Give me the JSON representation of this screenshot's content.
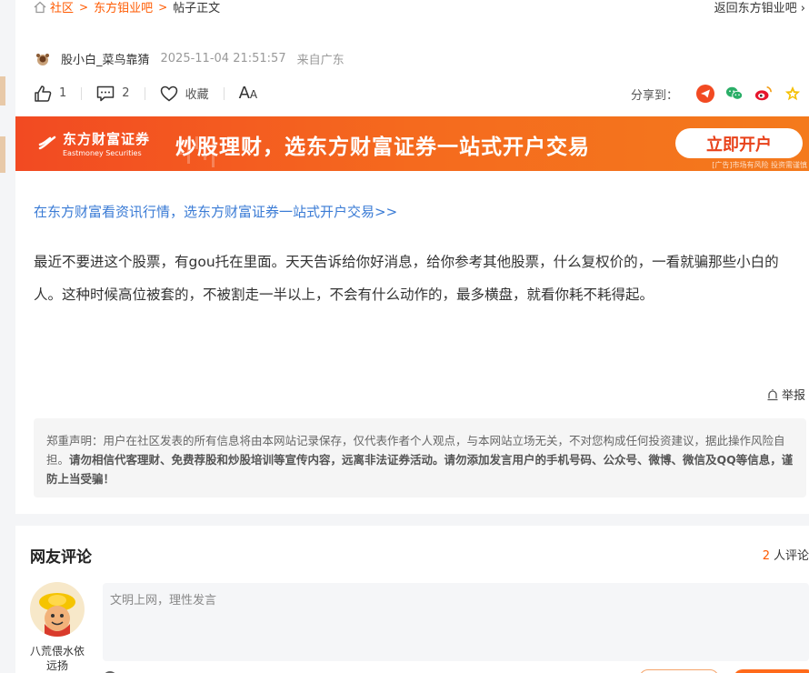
{
  "breadcrumb": {
    "home": "社区",
    "forum": "东方钼业吧",
    "current": "帖子正文"
  },
  "back_link": "返回东方钼业吧",
  "post": {
    "author": "股小白_菜鸟靠猜",
    "time": "2025-11-04 21:51:57",
    "location": "来自广东",
    "likes": "1",
    "comments": "2",
    "favorite_label": "收藏",
    "promo_link": "在东方财富看资讯行情，选东方财富证券一站式开户交易>>",
    "body": "最近不要进这个股票，有gou托在里面。天天告诉给你好消息，给你参考其他股票，什么复权价的，一看就骗那些小白的人。这种时候高位被套的，不被割走一半以上，不会有什么动作的，最多横盘，就看你耗不耗得起。"
  },
  "share": {
    "label": "分享到：",
    "icons": [
      "telegram-icon",
      "wechat-icon",
      "weibo-icon",
      "star-icon"
    ]
  },
  "banner": {
    "logo_cn": "东方财富证券",
    "logo_en": "Eastmoney Securities",
    "slogan": "炒股理财，选东方财富证券一站式开户交易",
    "cta": "立即开户",
    "ad_note": "[广告]市场有风险 投资需谨慎"
  },
  "report_label": "举报",
  "disclaimer": {
    "prefix": "郑重声明：用户在社区发表的所有信息将由本网站记录保存，仅代表作者个人观点，与本网站立场无关，不对您构成任何投资建议，据此操作风险自担。",
    "bold": "请勿相信代客理财、免费荐股和炒股培训等宣传内容，远离非法证券活动。请勿添加发言用户的手机号码、公众号、微博、微信及QQ等信息，谨防上当受骗！"
  },
  "comments_section": {
    "title": "网友评论",
    "count": "2",
    "count_suffix": "人评论",
    "user_name": "八荒偎水依远扬",
    "input_placeholder": "文明上网，理性发言"
  },
  "colors": {
    "accent": "#ff5a00",
    "link": "#3a7bd5",
    "banner": "#f24a22"
  }
}
